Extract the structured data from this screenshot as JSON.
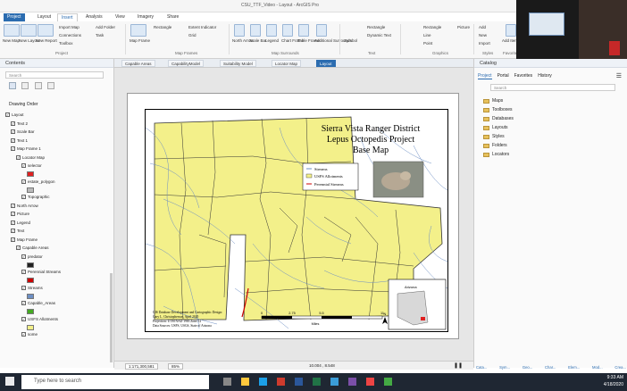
{
  "window": {
    "title": "CSU_TTF_Video - Layout - ArcGIS Pro"
  },
  "ribbon_tabs": [
    "Project",
    "Layout",
    "Insert",
    "Analysis",
    "View",
    "Imagery",
    "Share"
  ],
  "ribbon": {
    "new_map": "New Map",
    "new_layout": "New Layout",
    "new_report": "New Report",
    "import_map": "Import Map",
    "connections": "Connections",
    "toolbox": "Toolbox",
    "add_folder": "Add Folder",
    "task": "Task",
    "map_frame": "Map Frame",
    "rectangle": "Rectangle",
    "extent_indicator": "Extent Indicator",
    "grid": "Grid",
    "north_arrow": "North Arrow",
    "scale_bar": "Scale Bar",
    "legend": "Legend",
    "chart_frame": "Chart Frame",
    "table_frame": "Table Frame",
    "additional_surrounds": "Additional Surrounds",
    "symbol": "Symbol",
    "text_rect": "Rectangle",
    "dynamic_text": "Dynamic Text",
    "graphics_rect": "Rectangle",
    "line": "Line",
    "point": "Point",
    "picture": "Picture",
    "add_items": "Add",
    "new": "New",
    "import": "Import",
    "add_item": "Add Item",
    "groups": [
      "Project",
      "Map Frames",
      "Map Surrounds",
      "Text",
      "Graphics",
      "Styles",
      "Favorites"
    ]
  },
  "contents": {
    "title": "Contents",
    "search_placeholder": "Search",
    "drawing_order": "Drawing Order",
    "rows": [
      {
        "label": "Layout",
        "indent": 0
      },
      {
        "label": "Text 2",
        "indent": 1
      },
      {
        "label": "Scale Bar",
        "indent": 1
      },
      {
        "label": "Text 1",
        "indent": 1
      },
      {
        "label": "Map Frame 1",
        "indent": 1
      },
      {
        "label": "Locator Map",
        "indent": 2
      },
      {
        "label": "selector",
        "indent": 3
      },
      {
        "label": "",
        "indent": 4,
        "swatch": "#e02020"
      },
      {
        "label": "estate_polygon",
        "indent": 3
      },
      {
        "label": "",
        "indent": 4,
        "swatch": "#bbbbbb"
      },
      {
        "label": "Topographic",
        "indent": 3
      },
      {
        "label": "North Arrow",
        "indent": 1
      },
      {
        "label": "Picture",
        "indent": 1
      },
      {
        "label": "Legend",
        "indent": 1
      },
      {
        "label": "Text",
        "indent": 1
      },
      {
        "label": "Map Frame",
        "indent": 1
      },
      {
        "label": "Capable Areas",
        "indent": 2
      },
      {
        "label": "predator",
        "indent": 3
      },
      {
        "label": "",
        "indent": 4,
        "swatch": "#222222"
      },
      {
        "label": "Perennial Streams",
        "indent": 3
      },
      {
        "label": "",
        "indent": 4,
        "swatch": "#cc0000"
      },
      {
        "label": "Streams",
        "indent": 3
      },
      {
        "label": "",
        "indent": 4,
        "swatch": "#6d8fc4"
      },
      {
        "label": "Capable_Areas",
        "indent": 3
      },
      {
        "label": "",
        "indent": 4,
        "swatch": "#44aa22"
      },
      {
        "label": "USFS Allotments",
        "indent": 3
      },
      {
        "label": "",
        "indent": 4,
        "swatch": "#f3f08a"
      },
      {
        "label": "some",
        "indent": 3
      }
    ]
  },
  "doc_tabs": [
    "Capable Areas",
    "CapabilityModel",
    "Suitability Model",
    "Locator Map",
    "Layout"
  ],
  "layout": {
    "title_lines": [
      "Sierra Vista Ranger District",
      "Lepus Octopedis Project",
      "Base Map"
    ],
    "legend": [
      {
        "label": "Streams",
        "color": "#6d8fc4"
      },
      {
        "label": "USFS Allotments",
        "color": "#f3f08a"
      },
      {
        "label": "Perennial Streams",
        "color": "#cc0000"
      }
    ],
    "credits": [
      "GIS Database Development and Cartographic Design:",
      "Gary L. Christopherson, April 2020",
      "Projection: UTM NAD 1983 Zone 12",
      "Data Sources: USFS, USGS, State of Arizona"
    ],
    "scale_ticks": [
      "0",
      "2.75",
      "5.5",
      "11"
    ],
    "scale_units": "Miles",
    "locator_label": "Arizona",
    "north": "N"
  },
  "status": {
    "scale": "1:171,300,581",
    "zoom": "85%",
    "coords": "10.004 , 8.548"
  },
  "catalog": {
    "title": "Catalog",
    "tabs": [
      "Project",
      "Portal",
      "Favorites",
      "History"
    ],
    "search_placeholder": "Search",
    "items": [
      "Maps",
      "Toolboxes",
      "Databases",
      "Layouts",
      "Styles",
      "Folders",
      "Locators"
    ],
    "bottom_tabs": [
      "Cata...",
      "Sym...",
      "Geo...",
      "Char...",
      "Elem...",
      "Mod...",
      "Crea..."
    ]
  },
  "taskbar": {
    "search_placeholder": "Type here to search",
    "time": "9:33 AM",
    "date": "4/18/2020"
  },
  "colors": {
    "allotment": "#f3f08a",
    "stream": "#6d8fc4",
    "perennial": "#cc0000",
    "ribbon_accent": "#2b6cb0"
  }
}
